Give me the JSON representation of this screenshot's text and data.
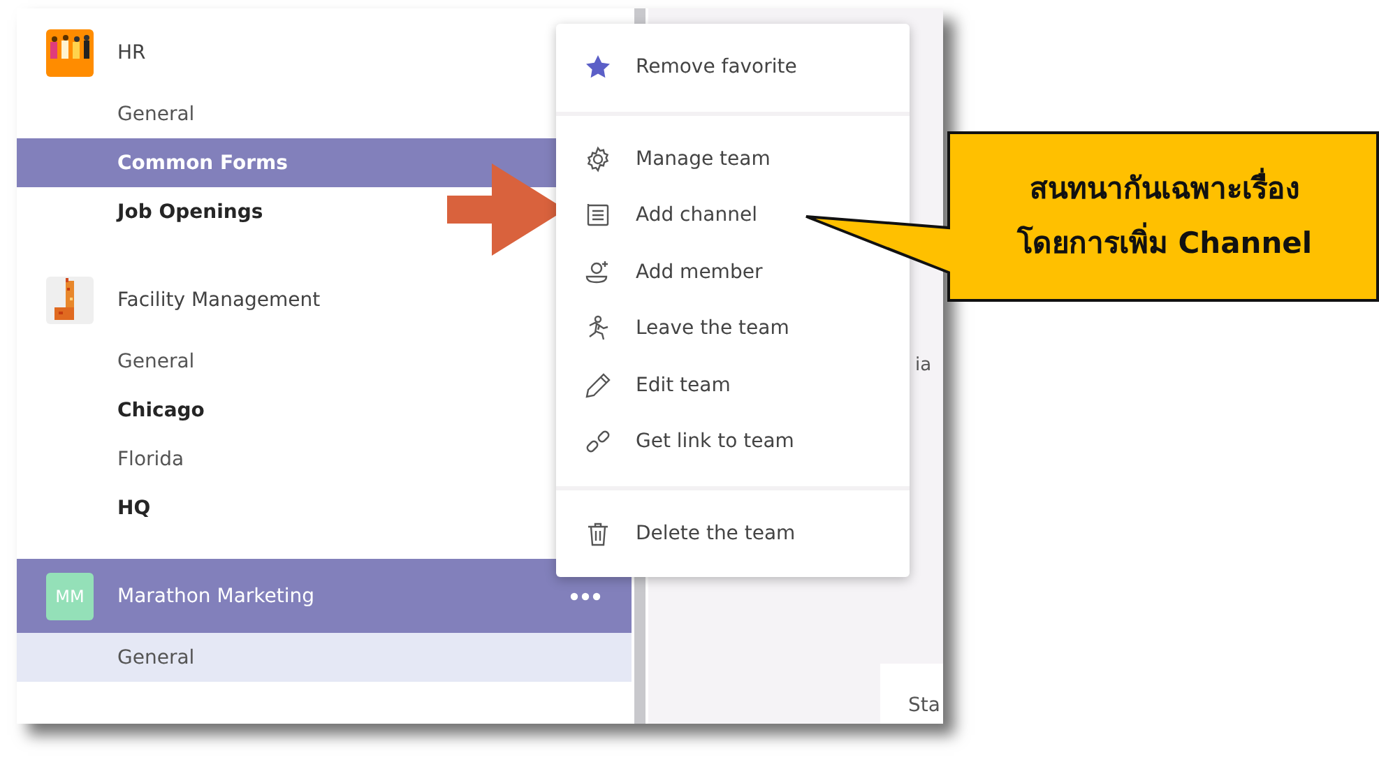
{
  "teams": [
    {
      "name": "HR",
      "avatar": {
        "kind": "picture"
      },
      "hovered": false,
      "channels": [
        {
          "name": "General",
          "unread": false,
          "hovered": false,
          "selected": false
        },
        {
          "name": "Common Forms",
          "unread": true,
          "hovered": true,
          "selected": false
        },
        {
          "name": "Job Openings",
          "unread": true,
          "hovered": false,
          "selected": false
        }
      ]
    },
    {
      "name": "Facility Management",
      "avatar": {
        "kind": "picture"
      },
      "hovered": false,
      "channels": [
        {
          "name": "General",
          "unread": false,
          "hovered": false,
          "selected": false
        },
        {
          "name": "Chicago",
          "unread": true,
          "hovered": false,
          "selected": false
        },
        {
          "name": "Florida",
          "unread": false,
          "hovered": false,
          "selected": false
        },
        {
          "name": "HQ",
          "unread": true,
          "hovered": false,
          "selected": false
        }
      ]
    },
    {
      "name": "Marathon Marketing",
      "avatar": {
        "kind": "initials",
        "text": "MM"
      },
      "hovered": true,
      "channels": [
        {
          "name": "General",
          "unread": false,
          "hovered": false,
          "selected": true
        }
      ]
    }
  ],
  "content": {
    "fragments": [
      "ia",
      "Sta"
    ]
  },
  "menu": {
    "sections": [
      [
        {
          "label": "Remove favorite"
        }
      ],
      [
        {
          "label": "Manage team"
        },
        {
          "label": "Add channel"
        },
        {
          "label": "Add member"
        },
        {
          "label": "Leave the team"
        },
        {
          "label": "Edit team"
        },
        {
          "label": "Get link to team"
        }
      ],
      [
        {
          "label": "Delete the team"
        }
      ]
    ]
  },
  "callout": {
    "lines": [
      "สนทนากันเฉพาะเรื่อง",
      "โดยการเพิ่ม Channel"
    ]
  }
}
